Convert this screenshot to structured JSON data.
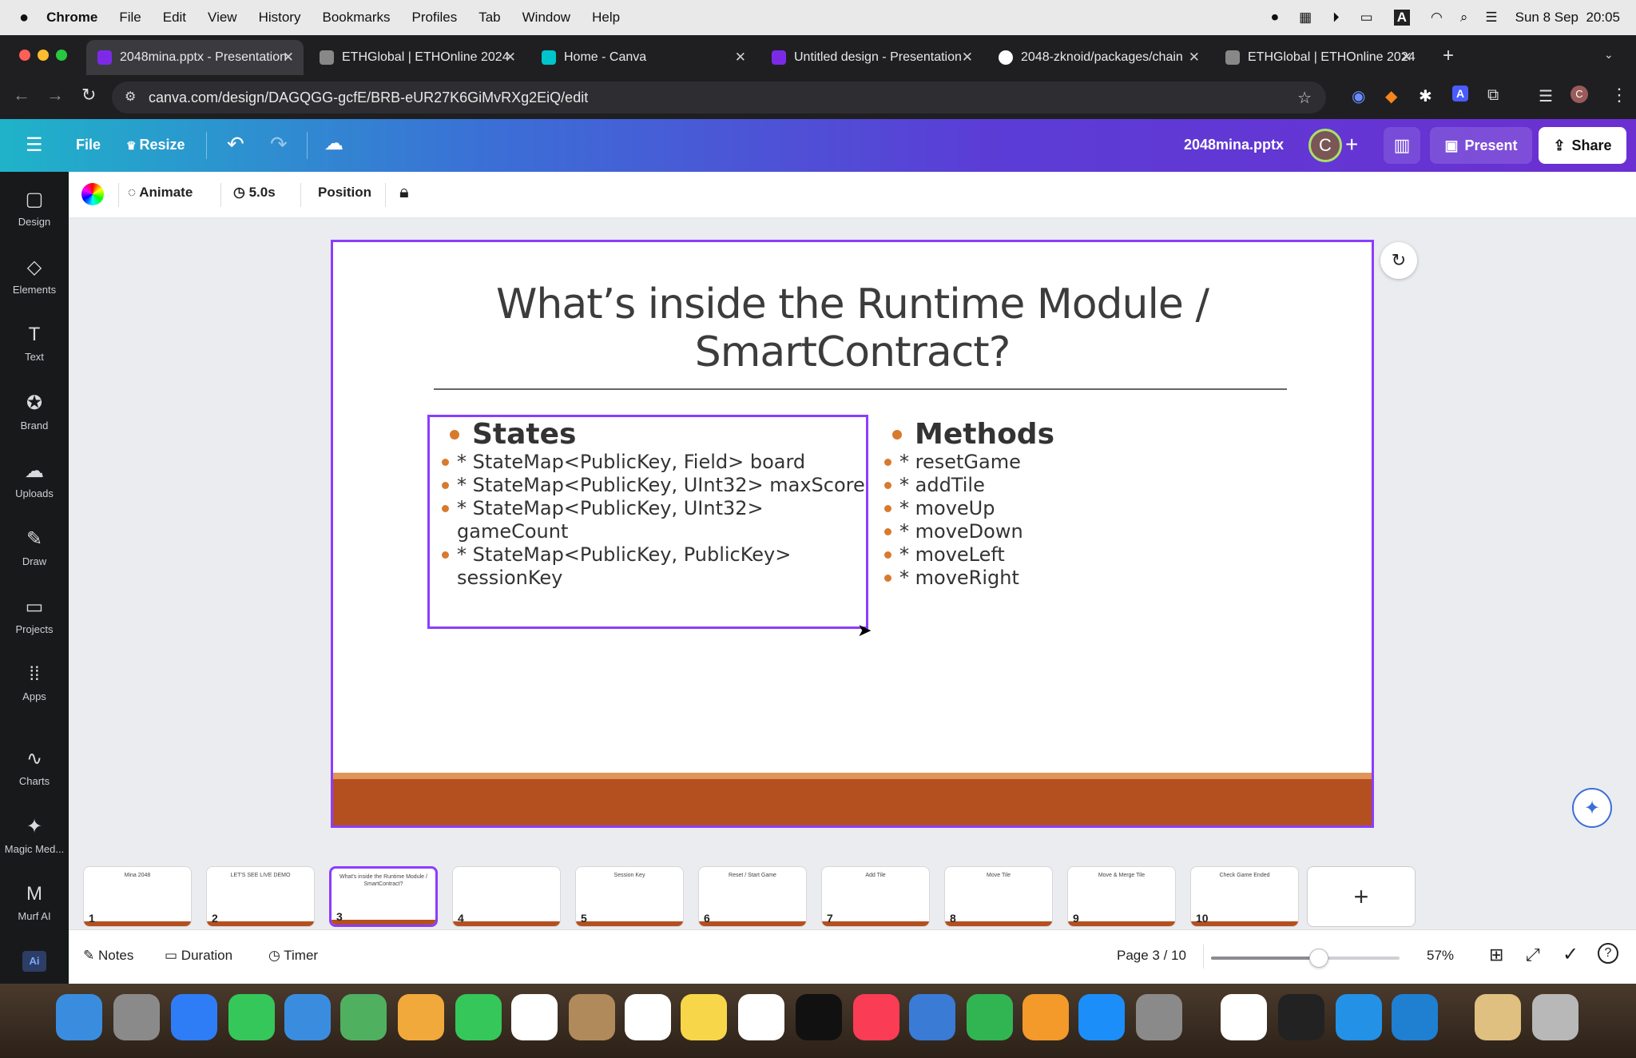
{
  "mac": {
    "app": "Chrome",
    "menus": [
      "File",
      "Edit",
      "View",
      "History",
      "Bookmarks",
      "Profiles",
      "Tab",
      "Window",
      "Help"
    ],
    "datetime": "Sun 8 Sep  20:05"
  },
  "browser": {
    "tabs": [
      {
        "title": "2048mina.pptx - Presentation",
        "color": "#7d2ae8"
      },
      {
        "title": "ETHGlobal | ETHOnline 2024",
        "color": "#888888"
      },
      {
        "title": "Home - Canva",
        "color": "#00c4cc"
      },
      {
        "title": "Untitled design - Presentation",
        "color": "#7d2ae8"
      },
      {
        "title": "2048-zknoid/packages/chain",
        "color": "#ffffff"
      },
      {
        "title": "ETHGlobal | ETHOnline 2024",
        "color": "#888888"
      }
    ],
    "url": "canva.com/design/DAGQGG-gcfE/BRB-eUR27K6GiMvRXg2EiQ/edit"
  },
  "canva": {
    "file_label": "File",
    "resize_label": "Resize",
    "doc_title": "2048mina.pptx",
    "avatar_letter": "C",
    "present_label": "Present",
    "share_label": "Share"
  },
  "sidebar": [
    {
      "label": "Design",
      "icon": "design-icon",
      "glyph": "▢"
    },
    {
      "label": "Elements",
      "icon": "elements-icon",
      "glyph": "◇"
    },
    {
      "label": "Text",
      "icon": "text-icon",
      "glyph": "T"
    },
    {
      "label": "Brand",
      "icon": "brand-icon",
      "glyph": "✪"
    },
    {
      "label": "Uploads",
      "icon": "uploads-icon",
      "glyph": "☁"
    },
    {
      "label": "Draw",
      "icon": "draw-icon",
      "glyph": "✎"
    },
    {
      "label": "Projects",
      "icon": "projects-icon",
      "glyph": "▭"
    },
    {
      "label": "Apps",
      "icon": "apps-icon",
      "glyph": "⁞⁞"
    },
    {
      "label": "Charts",
      "icon": "charts-icon",
      "glyph": "∿"
    },
    {
      "label": "Magic Med...",
      "icon": "magic-media-icon",
      "glyph": "✦"
    },
    {
      "label": "Murf AI",
      "icon": "murf-ai-icon",
      "glyph": "M"
    }
  ],
  "toolbar": {
    "animate_label": "Animate",
    "duration_label": "5.0s",
    "position_label": "Position"
  },
  "slide": {
    "title": "What’s inside the Runtime Module / SmartContract?",
    "states_heading": "States",
    "states": [
      "* StateMap<PublicKey, Field> board",
      "* StateMap<PublicKey, UInt32> maxScore",
      "* StateMap<PublicKey, UInt32> gameCount",
      "* StateMap<PublicKey, PublicKey> sessionKey"
    ],
    "methods_heading": "Methods",
    "methods": [
      "* resetGame",
      "* addTile",
      "* moveUp",
      "* moveDown",
      "* moveLeft",
      "* moveRight"
    ],
    "accent_color": "#b4501f",
    "bullet_color": "#d87a2e"
  },
  "thumbnails": [
    {
      "n": "1",
      "caption": "Mina 2048"
    },
    {
      "n": "2",
      "caption": "LET'S SEE LIVE DEMO"
    },
    {
      "n": "3",
      "caption": "What's inside the Runtime Module / SmartContract?"
    },
    {
      "n": "4",
      "caption": ""
    },
    {
      "n": "5",
      "caption": "Session Key"
    },
    {
      "n": "6",
      "caption": "Reset / Start Game"
    },
    {
      "n": "7",
      "caption": "Add Tile"
    },
    {
      "n": "8",
      "caption": "Move Tile"
    },
    {
      "n": "9",
      "caption": "Move & Merge Tile"
    },
    {
      "n": "10",
      "caption": "Check Game Ended"
    }
  ],
  "bottom": {
    "notes_label": "Notes",
    "duration_label": "Duration",
    "timer_label": "Timer",
    "page_label": "Page 3 / 10",
    "zoom_label": "57%",
    "zoom_level": 0.57
  }
}
